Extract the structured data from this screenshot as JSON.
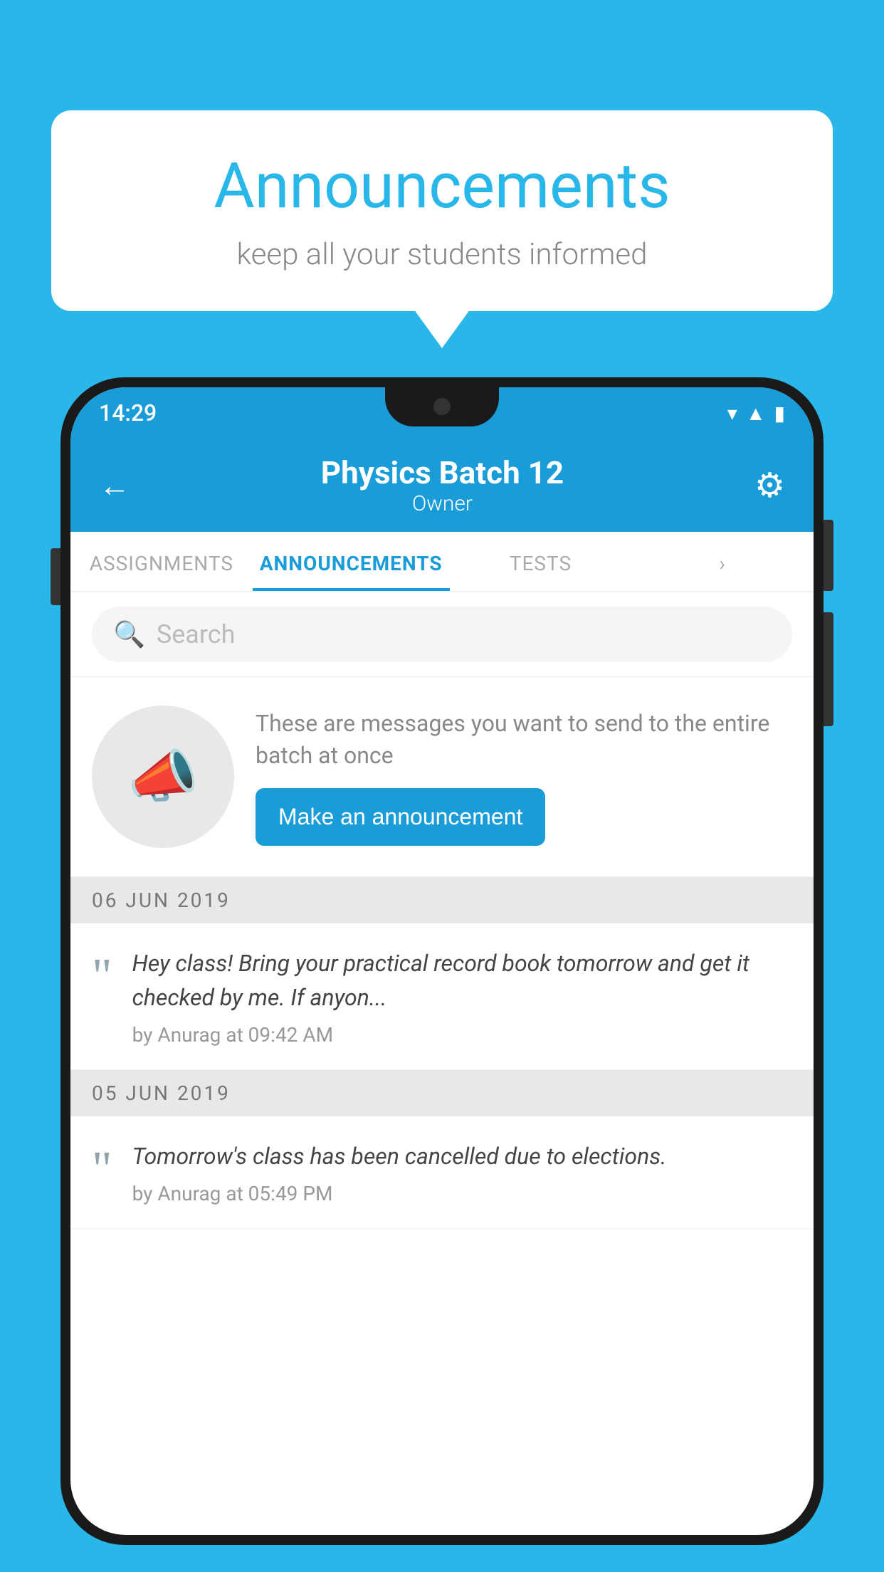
{
  "bubble": {
    "title": "Announcements",
    "subtitle": "keep all your students informed"
  },
  "status_bar": {
    "time": "14:29"
  },
  "header": {
    "title": "Physics Batch 12",
    "subtitle": "Owner"
  },
  "tabs": [
    {
      "label": "ASSIGNMENTS",
      "active": false
    },
    {
      "label": "ANNOUNCEMENTS",
      "active": true
    },
    {
      "label": "TESTS",
      "active": false
    },
    {
      "label": "",
      "active": false
    }
  ],
  "search": {
    "placeholder": "Search"
  },
  "promo": {
    "description": "These are messages you want to send to the entire batch at once",
    "button_label": "Make an announcement"
  },
  "announcements": [
    {
      "date": "06  JUN  2019",
      "text": "Hey class! Bring your practical record book tomorrow and get it checked by me. If anyon...",
      "meta": "by Anurag at 09:42 AM"
    },
    {
      "date": "05  JUN  2019",
      "text": "Tomorrow's class has been cancelled due to elections.",
      "meta": "by Anurag at 05:49 PM"
    }
  ],
  "colors": {
    "primary": "#1a9cd8",
    "background": "#29b6e8",
    "white": "#ffffff"
  }
}
